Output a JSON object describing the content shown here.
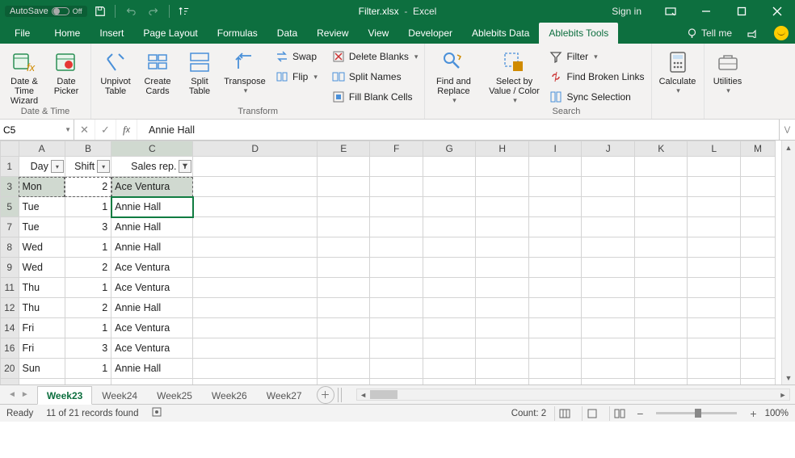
{
  "title": {
    "filename": "Filter.xlsx",
    "app": "Excel",
    "autosave_label": "AutoSave",
    "autosave_state": "Off",
    "signin": "Sign in"
  },
  "tabs": {
    "file": "File",
    "items": [
      "Home",
      "Insert",
      "Page Layout",
      "Formulas",
      "Data",
      "Review",
      "View",
      "Developer",
      "Ablebits Data",
      "Ablebits Tools"
    ],
    "active_index": 9,
    "tellme": "Tell me"
  },
  "ribbon": {
    "group_datetime": {
      "label": "Date & Time",
      "date_time_wizard": "Date &\nTime Wizard",
      "date_picker": "Date\nPicker"
    },
    "group_transform": {
      "label": "Transform",
      "unpivot": "Unpivot\nTable",
      "create_cards": "Create\nCards",
      "split_table": "Split\nTable",
      "transpose": "Transpose",
      "swap": "Swap",
      "flip": "Flip",
      "delete_blanks": "Delete Blanks",
      "split_names": "Split Names",
      "fill_blank": "Fill Blank Cells"
    },
    "group_findreplace": {
      "find_replace": "Find and\nReplace"
    },
    "group_search": {
      "label": "Search",
      "select": "Select by\nValue / Color",
      "filter": "Filter",
      "broken_links": "Find Broken Links",
      "sync": "Sync Selection"
    },
    "group_calculate": {
      "calculate": "Calculate"
    },
    "group_utilities": {
      "utilities": "Utilities"
    }
  },
  "formula": {
    "namebox": "C5",
    "value": "Annie Hall"
  },
  "columns": [
    "A",
    "B",
    "C",
    "D",
    "E",
    "F",
    "G",
    "H",
    "I",
    "J",
    "K",
    "L",
    "M"
  ],
  "headers": {
    "day": "Day",
    "shift": "Shift",
    "salesrep": "Sales rep."
  },
  "rows": [
    {
      "n": 3,
      "day": "Mon",
      "shift": 2,
      "rep": "Ace Ventura"
    },
    {
      "n": 5,
      "day": "Tue",
      "shift": 1,
      "rep": "Annie Hall"
    },
    {
      "n": 7,
      "day": "Tue",
      "shift": 3,
      "rep": "Annie Hall"
    },
    {
      "n": 8,
      "day": "Wed",
      "shift": 1,
      "rep": "Annie Hall"
    },
    {
      "n": 9,
      "day": "Wed",
      "shift": 2,
      "rep": "Ace Ventura"
    },
    {
      "n": 11,
      "day": "Thu",
      "shift": 1,
      "rep": "Ace Ventura"
    },
    {
      "n": 12,
      "day": "Thu",
      "shift": 2,
      "rep": "Annie Hall"
    },
    {
      "n": 14,
      "day": "Fri",
      "shift": 1,
      "rep": "Ace Ventura"
    },
    {
      "n": 16,
      "day": "Fri",
      "shift": 3,
      "rep": "Ace Ventura"
    },
    {
      "n": 20,
      "day": "Sun",
      "shift": 1,
      "rep": "Annie Hall"
    }
  ],
  "sheets": {
    "items": [
      "Week23",
      "Week24",
      "Week25",
      "Week26",
      "Week27"
    ],
    "active_index": 0
  },
  "status": {
    "ready": "Ready",
    "records": "11 of 21 records found",
    "count_label": "Count:",
    "count": 2,
    "zoom": "100%"
  }
}
